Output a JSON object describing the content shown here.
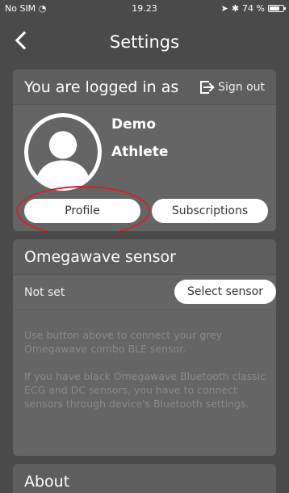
{
  "status_bar": {
    "carrier": "No SIM",
    "time": "19.23",
    "battery_text": "74 %",
    "battery_level": 0.74
  },
  "nav": {
    "title": "Settings"
  },
  "account": {
    "heading": "You are logged in as",
    "sign_out_label": "Sign out",
    "first_name": "Demo",
    "last_name": "Athlete",
    "profile_label": "Profile",
    "subscriptions_label": "Subscriptions",
    "highlight_color": "#d6202a"
  },
  "sensor": {
    "heading": "Omegawave sensor",
    "status": "Not set",
    "select_label": "Select sensor",
    "help_1": "Use button above to connect your grey Omegawave combo BLE sensor.",
    "help_2": "If you have black Omegawave Bluetooth classic ECG and DC sensors, you have to connect sensors through device's Bluetooth settings."
  },
  "about": {
    "heading": "About"
  },
  "icons": [
    "wifi-icon",
    "location-icon",
    "bluetooth-icon",
    "battery-icon",
    "back-chevron-icon",
    "sign-out-icon",
    "avatar-icon"
  ]
}
